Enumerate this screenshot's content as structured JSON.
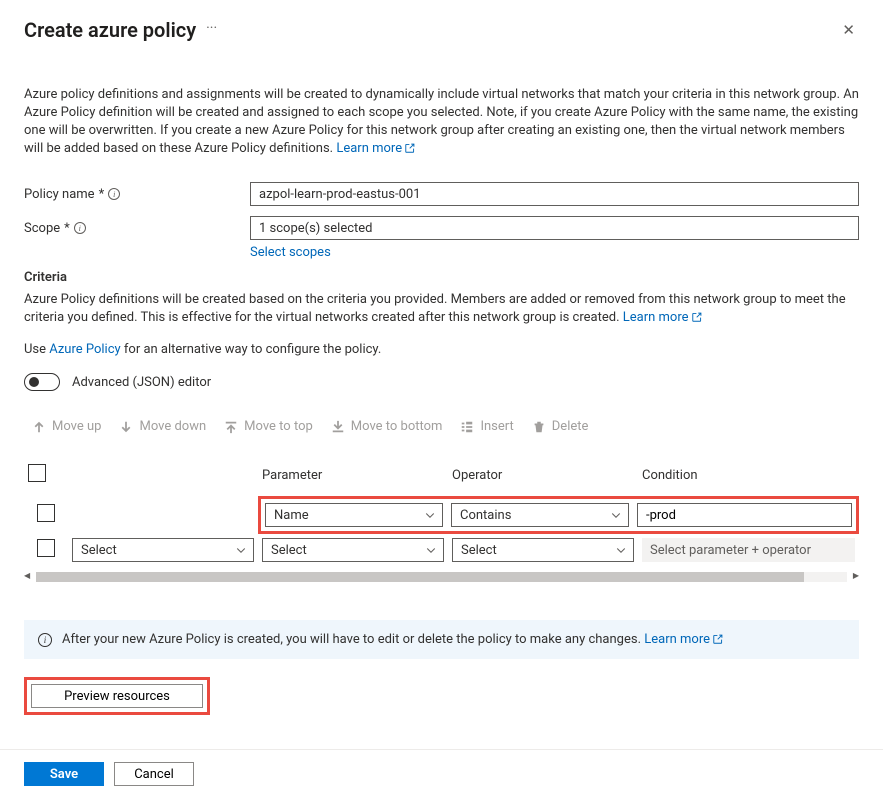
{
  "header": {
    "title": "Create azure policy"
  },
  "description": {
    "text": "Azure policy definitions and assignments will be created to dynamically include virtual networks that match your criteria in this network group. An Azure Policy definition will be created and assigned to each scope you selected. Note, if you create Azure Policy with the same name, the existing one will be overwritten. If you create a new Azure Policy for this network group after creating an existing one, then the virtual network members will be added based on these Azure Policy definitions.",
    "learn_more": "Learn more"
  },
  "form": {
    "policy_name_label": "Policy name",
    "policy_name_value": "azpol-learn-prod-eastus-001",
    "scope_label": "Scope",
    "scope_value": "1 scope(s) selected",
    "select_scopes": "Select scopes"
  },
  "criteria": {
    "title": "Criteria",
    "text1a": "Azure Policy definitions will be created based on the criteria you provided. Members are added or removed from this network group to meet the criteria you defined. This is effective for the virtual networks created after this network group is created.",
    "learn_more": "Learn more",
    "text2_pre": "Use ",
    "text2_link": "Azure Policy",
    "text2_post": " for an alternative way to configure the policy.",
    "toggle_label": "Advanced (JSON) editor"
  },
  "toolbar": {
    "move_up": "Move up",
    "move_down": "Move down",
    "move_to_top": "Move to top",
    "move_to_bottom": "Move to bottom",
    "insert": "Insert",
    "delete": "Delete"
  },
  "table": {
    "headers": {
      "parameter": "Parameter",
      "operator": "Operator",
      "condition": "Condition"
    },
    "row1": {
      "parameter": "Name",
      "operator": "Contains",
      "condition": "-prod"
    },
    "row2": {
      "logic": "Select",
      "parameter": "Select",
      "operator": "Select",
      "condition": "Select parameter + operator"
    }
  },
  "banner": {
    "text": "After your new Azure Policy is created, you will have to edit or delete the policy to make any changes.",
    "learn_more": "Learn more"
  },
  "buttons": {
    "preview": "Preview resources",
    "save": "Save",
    "cancel": "Cancel"
  }
}
